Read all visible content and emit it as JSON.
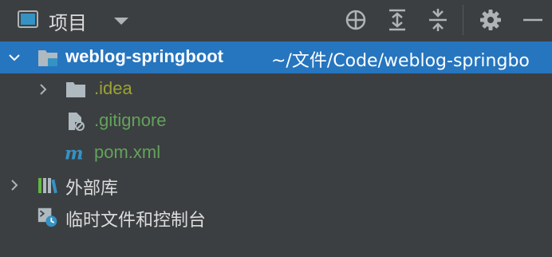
{
  "panel": {
    "title": "项目",
    "accent_color": "#2675bf"
  },
  "toolbar_icons": [
    "project-view-icon",
    "dropdown-chevron-icon",
    "locate-target-icon",
    "expand-all-icon",
    "collapse-all-icon",
    "gear-icon",
    "minimize-icon"
  ],
  "tree": {
    "root": {
      "name": "weblog-springboot",
      "path": "~/文件/Code/weblog-springbo",
      "icon": "module-folder-icon"
    },
    "children": [
      {
        "name": ".idea",
        "icon": "folder-icon",
        "color": "#9aa334"
      },
      {
        "name": ".gitignore",
        "icon": "ignored-file-icon",
        "color": "#62a35c"
      },
      {
        "name": "pom.xml",
        "icon": "maven-icon",
        "color": "#62a35c"
      }
    ],
    "external_libraries": {
      "name": "外部库",
      "icon": "libraries-icon"
    },
    "scratches": {
      "name": "临时文件和控制台",
      "icon": "scratches-icon"
    }
  }
}
